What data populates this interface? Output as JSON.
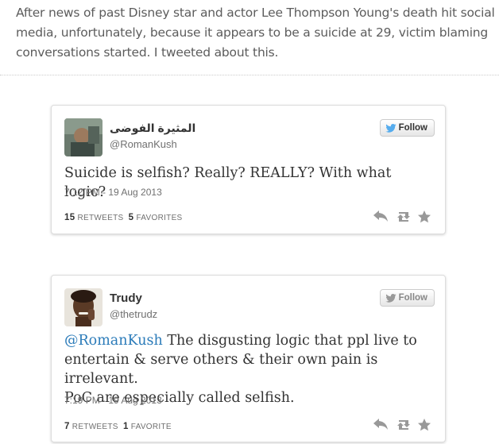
{
  "intro": {
    "line1": "After news of past Disney star and actor Lee Thompson Young's death hit social",
    "line2": "media, unfortunately, because it appears to be a suicide at 29, victim blaming",
    "line3": "conversations started. I tweeted about this."
  },
  "colors": {
    "link": "#2b7bb9",
    "twitter_blue": "#55acee"
  },
  "tweets": [
    {
      "name": "المثيرة الفوضى",
      "handle": "@RomanKush",
      "follow_label": "Follow",
      "text": "Suicide is selfish? Really? REALLY? With what logic?",
      "timestamp": "7:12 PM - 19 Aug 2013",
      "retweets": "15",
      "retweets_label": "RETWEETS",
      "favorites": "5",
      "favorites_label": "FAVORITES"
    },
    {
      "name": "Trudy",
      "handle": "@thetrudz",
      "follow_label": "Follow",
      "mention": "@RomanKush",
      "text_line1": "The disgusting logic that ppl live to",
      "text_line2": "entertain & serve others & their own pain is irrelevant.",
      "text_line3": "PoC are especially called selfish.",
      "timestamp": "7:19 PM - 19 Aug 2013",
      "retweets": "7",
      "retweets_label": "RETWEETS",
      "favorites": "1",
      "favorites_label": "FAVORITE"
    }
  ]
}
